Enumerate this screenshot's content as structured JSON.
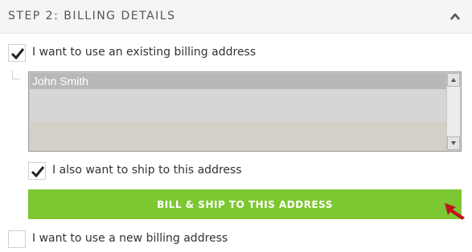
{
  "header": {
    "title": "STEP 2: BILLING DETAILS",
    "caret_icon": "chevron-up-icon"
  },
  "existing_address": {
    "label": "I want to use an existing billing address",
    "checked": true
  },
  "address_list": {
    "selected": "John Smith"
  },
  "ship_to_address": {
    "label": "I also want to ship to this address",
    "checked": true
  },
  "bill_ship_button": {
    "label": "BILL & SHIP TO THIS ADDRESS"
  },
  "new_address": {
    "label": "I want to use a new billing address",
    "checked": false
  },
  "colors": {
    "accent": "#7dc832",
    "arrow": "#c0141c"
  }
}
